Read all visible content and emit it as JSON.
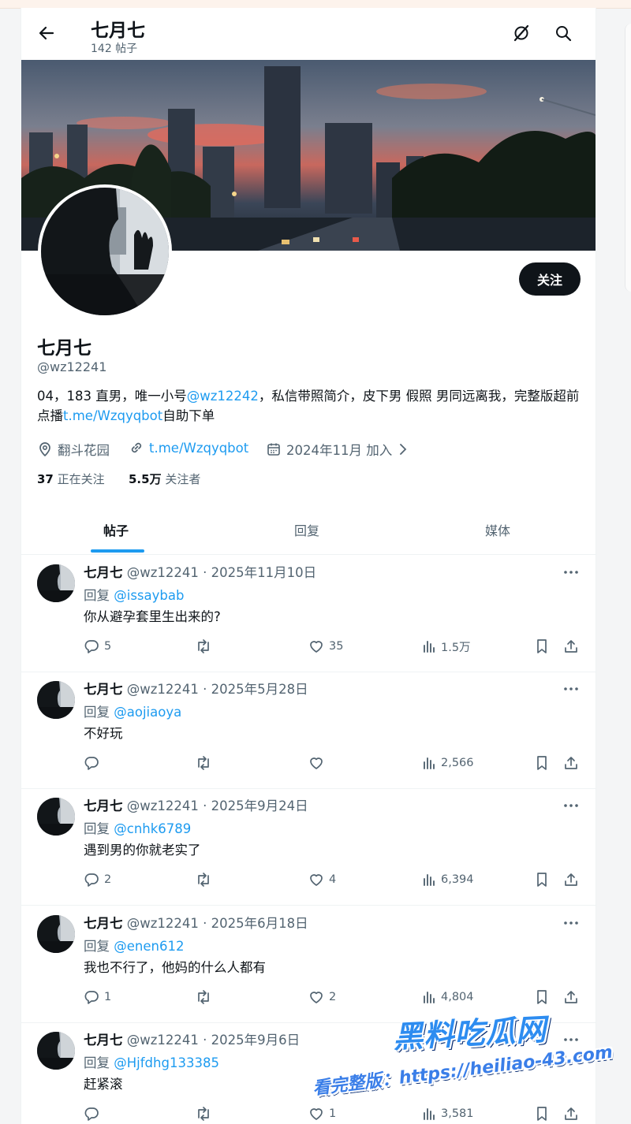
{
  "header": {
    "title": "七月七",
    "post_count": "142 帖子"
  },
  "profile": {
    "name": "七月七",
    "handle": "@wz12241",
    "bio_part1": "04，183 直男，唯一小号",
    "bio_mention": "@wz12242",
    "bio_part2": "，私信带照简介，皮下男 假照 男同远离我，完整版超前点播",
    "bio_link": "t.me/Wzqyqbot",
    "bio_part3": "自助下单",
    "location": "翻斗花园",
    "website": "t.me/Wzqyqbot",
    "joined": "2024年11月 加入",
    "following_count": "37",
    "following_label": "正在关注",
    "followers_count": "5.5万",
    "followers_label": "关注者",
    "follow_button": "关注"
  },
  "tabs": [
    {
      "label": "帖子",
      "active": true
    },
    {
      "label": "回复",
      "active": false
    },
    {
      "label": "媒体",
      "active": false
    }
  ],
  "tweets": [
    {
      "name": "七月七",
      "meta": "@wz12241 · 2025年11月10日",
      "reply_prefix": "回复 ",
      "reply_to": "@issaybab",
      "text": "你从避孕套里生出来的?",
      "replies": "5",
      "retweets": "",
      "likes": "35",
      "views": "1.5万"
    },
    {
      "name": "七月七",
      "meta": "@wz12241 · 2025年5月28日",
      "reply_prefix": "回复 ",
      "reply_to": "@aojiaoya",
      "text": "不好玩",
      "replies": "",
      "retweets": "",
      "likes": "",
      "views": "2,566"
    },
    {
      "name": "七月七",
      "meta": "@wz12241 · 2025年9月24日",
      "reply_prefix": "回复 ",
      "reply_to": "@cnhk6789",
      "text": "遇到男的你就老实了",
      "replies": "2",
      "retweets": "",
      "likes": "4",
      "views": "6,394"
    },
    {
      "name": "七月七",
      "meta": "@wz12241 · 2025年6月18日",
      "reply_prefix": "回复 ",
      "reply_to": "@enen612",
      "text": "我也不行了，他妈的什么人都有",
      "replies": "1",
      "retweets": "",
      "likes": "2",
      "views": "4,804"
    },
    {
      "name": "七月七",
      "meta": "@wz12241 · 2025年9月6日",
      "reply_prefix": "回复 ",
      "reply_to": "@Hjfdhg133385",
      "text": "赶紧滚",
      "replies": "",
      "retweets": "",
      "likes": "1",
      "views": "3,581"
    }
  ],
  "watermark": {
    "title": "黑料吃瓜网",
    "url": "看完整版：https://heiliao-43.com"
  },
  "colors": {
    "accent": "#1d9bf0",
    "text": "#0f1419",
    "secondary": "#536471",
    "follow_bg": "#0f1419"
  }
}
